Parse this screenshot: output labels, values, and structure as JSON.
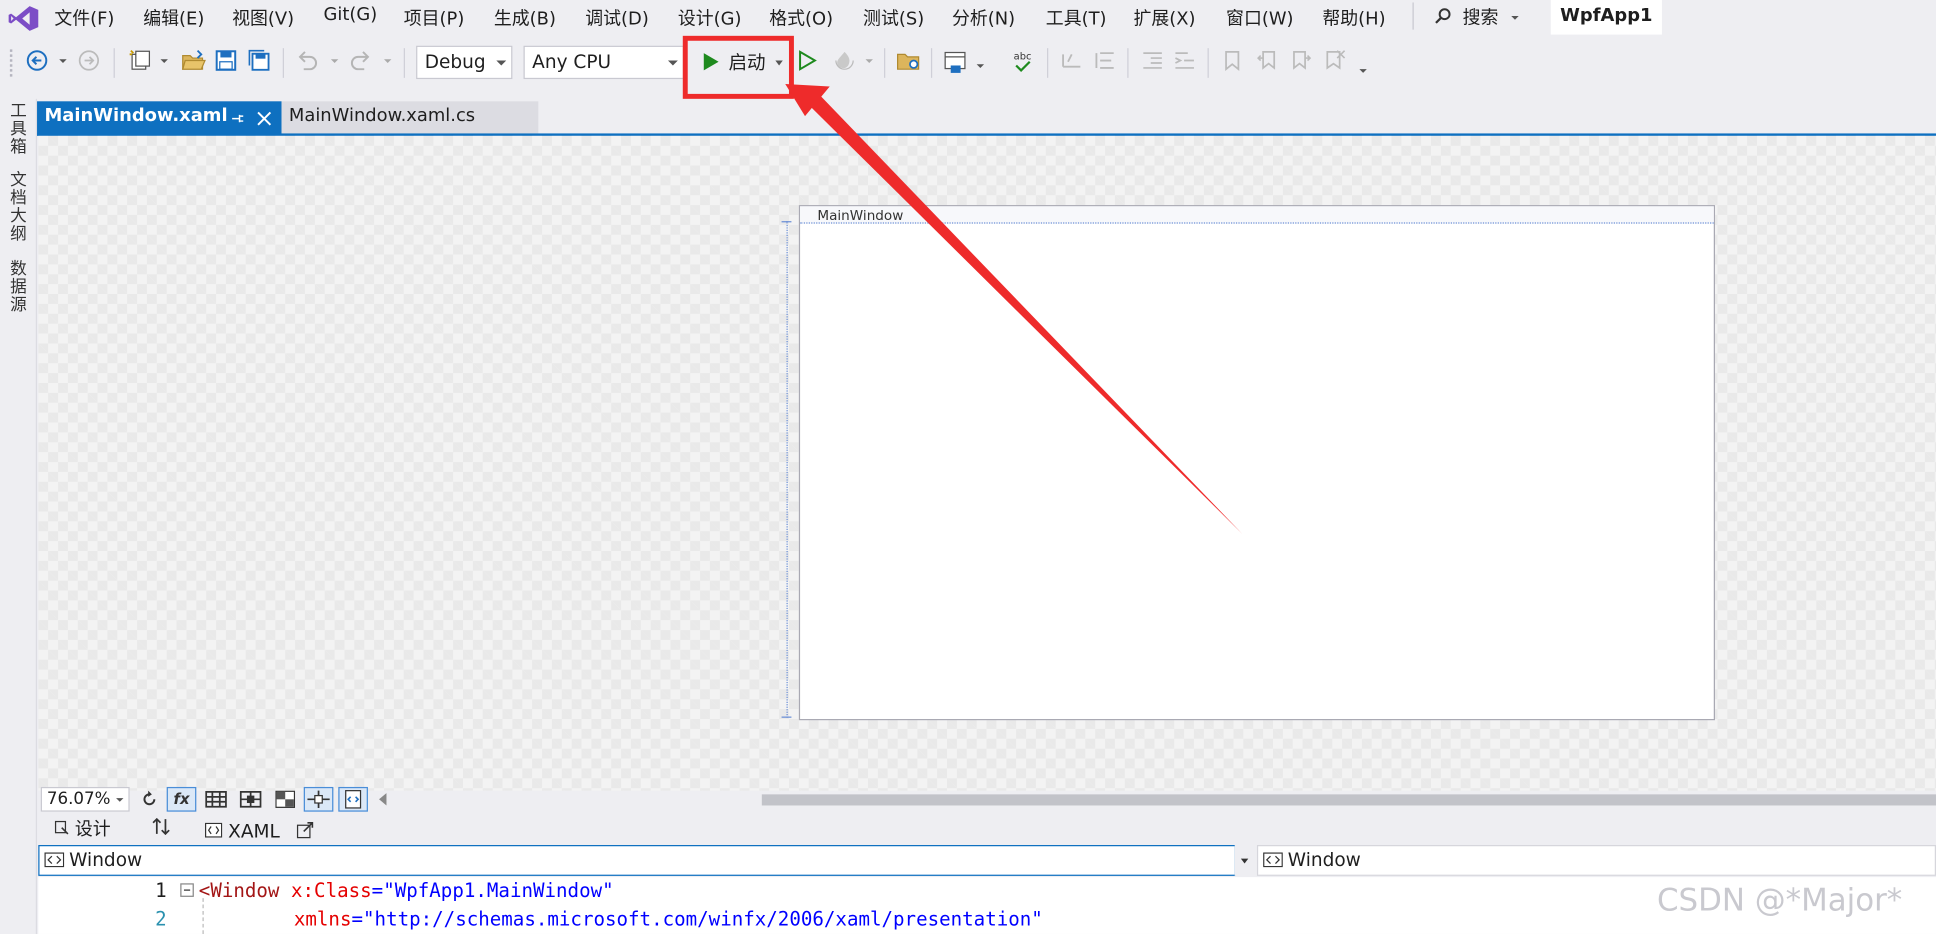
{
  "menu": {
    "items": [
      "文件(F)",
      "编辑(E)",
      "视图(V)",
      "Git(G)",
      "项目(P)",
      "生成(B)",
      "调试(D)",
      "设计(G)",
      "格式(O)",
      "测试(S)",
      "分析(N)",
      "工具(T)",
      "扩展(X)",
      "窗口(W)",
      "帮助(H)"
    ],
    "search_label": "搜索",
    "project_name": "WpfApp1"
  },
  "toolbar": {
    "config_value": "Debug",
    "platform_value": "Any CPU",
    "start_label": "启动"
  },
  "side_rail": {
    "items": [
      "工具箱",
      "文档大纲",
      "数据源"
    ]
  },
  "tabs": [
    {
      "label": "MainWindow.xaml",
      "active": true
    },
    {
      "label": "MainWindow.xaml.cs",
      "active": false
    }
  ],
  "designer": {
    "window_title": "MainWindow",
    "zoom": "76.07%"
  },
  "view_tabs": {
    "design_label": "设计",
    "xaml_label": "XAML"
  },
  "nav": {
    "left_value": "Window",
    "right_value": "Window"
  },
  "code": {
    "line1_num": "1",
    "line2_num": "2",
    "line1_bracket": "<",
    "line1_tag": "Window",
    "line1_attr": "x:Class",
    "line1_eq": "=",
    "line1_val": "\"WpfApp1.MainWindow\"",
    "line2_attr": "xmlns",
    "line2_eq": "=",
    "line2_val": "\"http://schemas.microsoft.com/winfx/2006/xaml/presentation\""
  },
  "watermark": "CSDN @*Major*",
  "colors": {
    "accent": "#0e70c0",
    "highlight": "#ee2b2b",
    "play": "#1e8a1e"
  }
}
